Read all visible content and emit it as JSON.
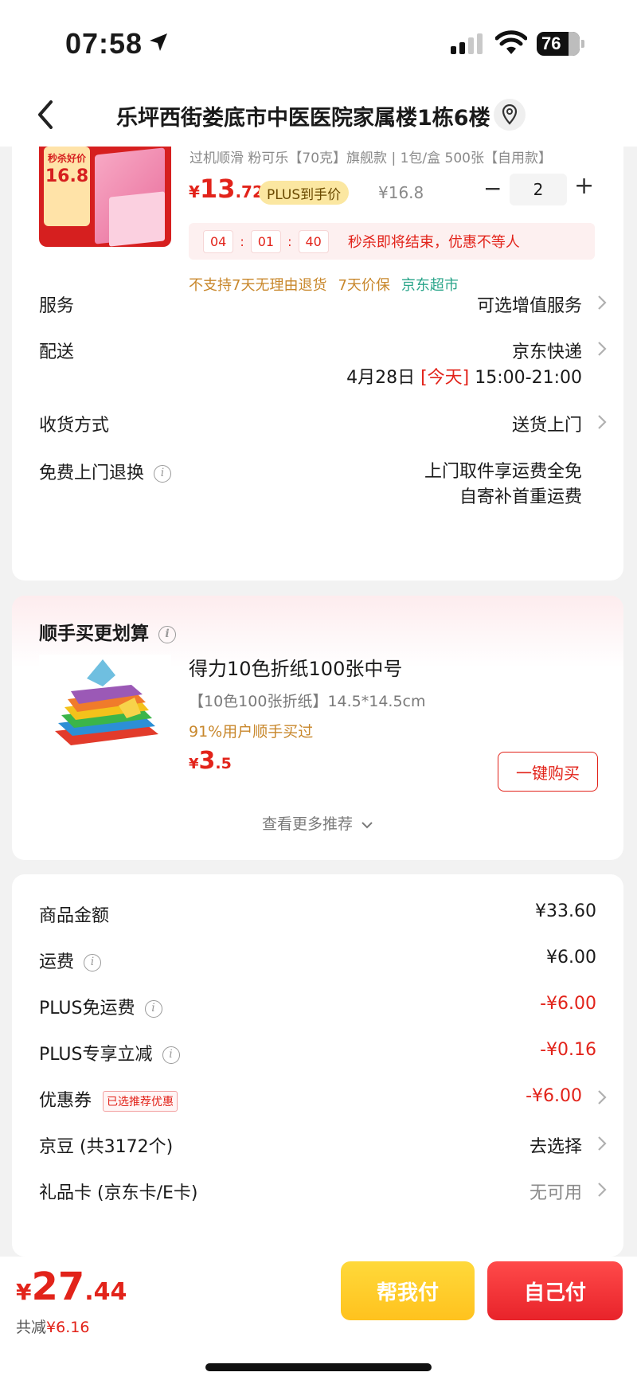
{
  "status_bar": {
    "time": "07:58",
    "battery": "76"
  },
  "nav": {
    "title": "乐坪西街娄底市中医医院家属楼1栋6楼"
  },
  "product": {
    "thumb_badge_top": "秒杀好价",
    "thumb_badge_price": "16.8",
    "spec": "过机顺滑 粉可乐【70克】旗舰款 | 1包/盒 500张【自用款】",
    "price_yen": "¥",
    "price_int": "13",
    "price_dec": ".72",
    "plus_label": "PLUS到手价",
    "price_old": "¥16.8",
    "qty_minus": "−",
    "qty": "2",
    "qty_plus": "+",
    "countdown": {
      "h": "04",
      "m": "01",
      "s": "40",
      "sep": ":",
      "text": "秒杀即将结束，优惠不等人"
    },
    "tags": {
      "no_return": "不支持7天无理由退货",
      "price_protect": "7天价保",
      "store": "京东超市"
    }
  },
  "service": {
    "label": "服务",
    "value": "可选增值服务",
    "delivery_label": "配送",
    "delivery_value": "京东快递",
    "delivery_date": "4月28日",
    "delivery_today": "[今天]",
    "delivery_time": "15:00-21:00",
    "receive_label": "收货方式",
    "receive_value": "送货上门",
    "free_return_label": "免费上门退换",
    "free_return_line1": "上门取件享运费全免",
    "free_return_line2": "自寄补首重运费"
  },
  "recommend": {
    "title": "顺手买更划算",
    "item_title": "得力10色折纸100张中号",
    "item_spec": "【10色100张折纸】14.5*14.5cm",
    "item_social": "91%用户顺手买过",
    "price_yen": "¥",
    "price_int": "3",
    "price_dec": ".5",
    "buy_label": "一键购买",
    "more_label": "查看更多推荐"
  },
  "summary": {
    "goods_label": "商品金额",
    "goods_value": "¥33.60",
    "shipping_label": "运费",
    "shipping_value": "¥6.00",
    "plus_free_label": "PLUS免运费",
    "plus_free_value": "-¥6.00",
    "plus_discount_label": "PLUS专享立减",
    "plus_discount_value": "-¥0.16",
    "coupon_label": "优惠券",
    "coupon_tag": "已选推荐优惠",
    "coupon_value": "-¥6.00",
    "jingdou_label": "京豆 (共3172个)",
    "jingdou_value": "去选择",
    "giftcard_label": "礼品卡 (京东卡/E卡)",
    "giftcard_value": "无可用"
  },
  "bottom": {
    "total_yen": "¥",
    "total_int": "27",
    "total_dec": ".44",
    "saved_label": "共减",
    "saved_value": "¥6.16",
    "friend_pay": "帮我付",
    "self_pay": "自己付"
  },
  "colors": {
    "accent_red": "#e2231a",
    "gold": "#ffc21e",
    "green": "#2aa58a",
    "orange": "#c8872b"
  }
}
